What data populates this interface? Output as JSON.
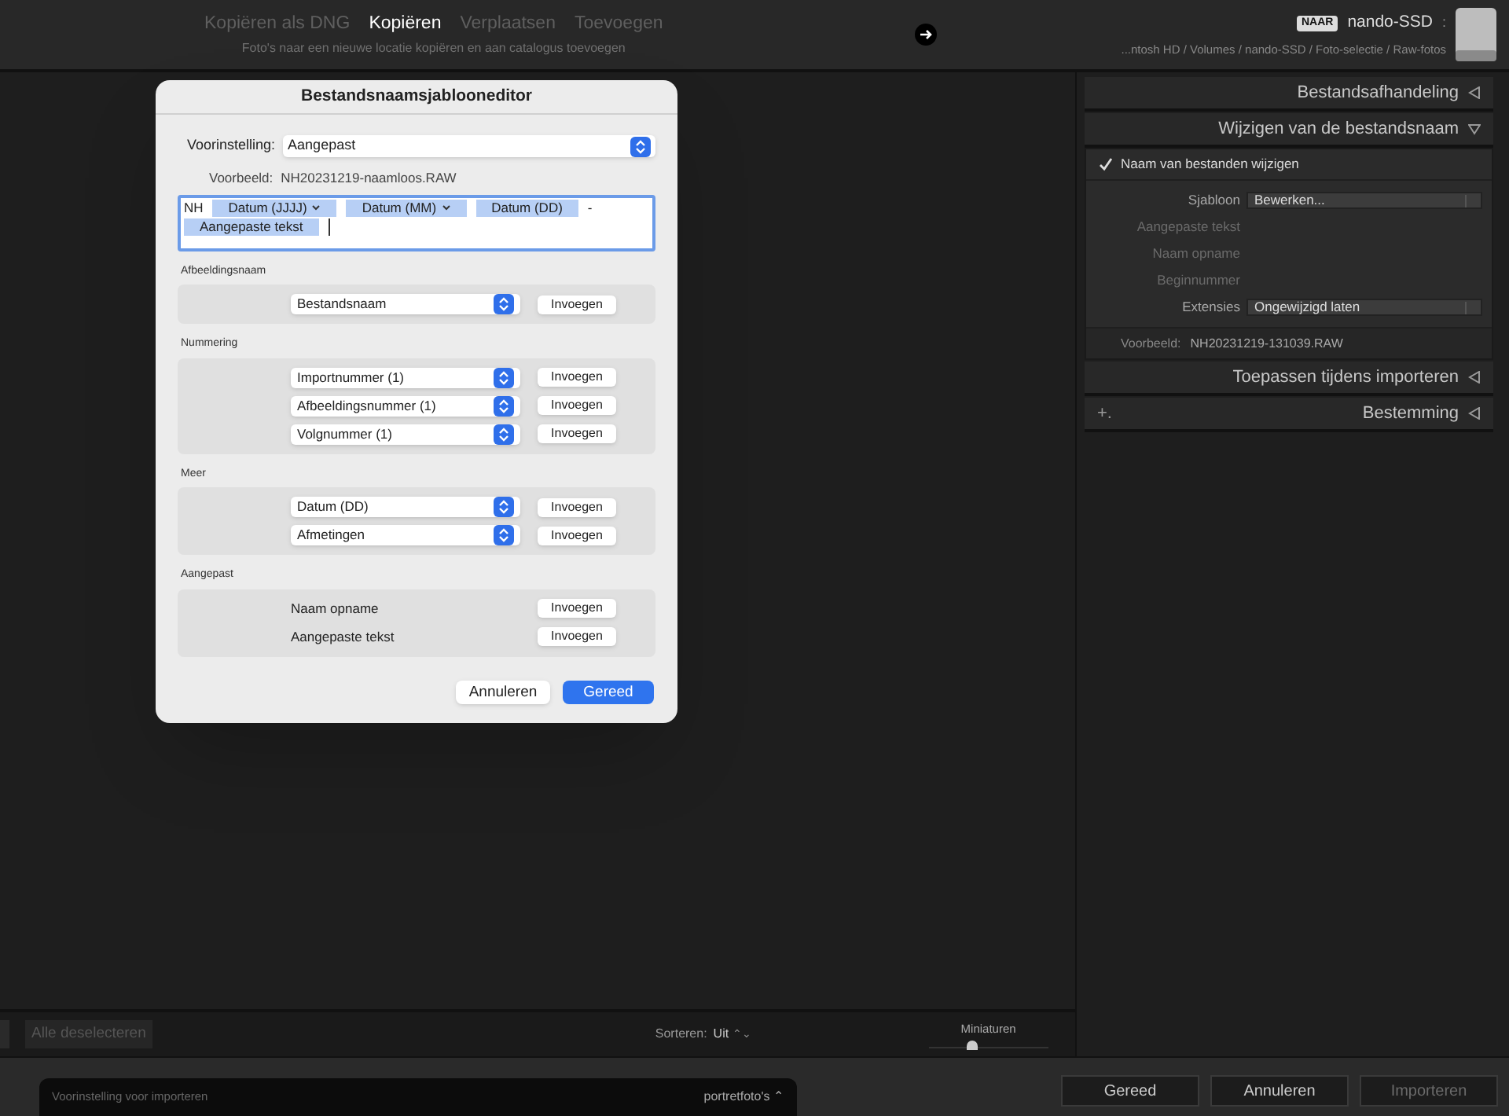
{
  "top_bar": {
    "modes": [
      {
        "label": "Kopiëren als DNG",
        "selected": false
      },
      {
        "label": "Kopiëren",
        "selected": true
      },
      {
        "label": "Verplaatsen",
        "selected": false
      },
      {
        "label": "Toevoegen",
        "selected": false
      }
    ],
    "mode_description": "Foto's naar een nieuwe locatie kopiëren en aan catalogus toevoegen",
    "destination_badge": "NAAR",
    "destination_name": "nando-SSD",
    "destination_caret": ":",
    "destination_path": "...ntosh HD / Volumes / nando-SSD / Foto-selectie / Raw-fotos"
  },
  "dialog": {
    "title": "Bestandsnaamsjablooneditor",
    "preset_label": "Voorinstelling:",
    "preset_value": "Aangepast",
    "example_label": "Voorbeeld:",
    "example_value": "NH20231219-naamloos.RAW",
    "template": [
      {
        "kind": "text",
        "text": "NH"
      },
      {
        "kind": "token",
        "text": "Datum (JJJJ)"
      },
      {
        "kind": "token",
        "text": "Datum (MM)"
      },
      {
        "kind": "token",
        "text": "Datum (DD)"
      },
      {
        "kind": "text",
        "text": "-"
      },
      {
        "kind": "token",
        "text": "Aangepaste tekst"
      }
    ],
    "sections": [
      {
        "title": "Afbeeldingsnaam",
        "rows": [
          {
            "kind": "select",
            "text": "Bestandsnaam",
            "button": "Invoegen"
          }
        ]
      },
      {
        "title": "Nummering",
        "rows": [
          {
            "kind": "select",
            "text": "Importnummer (1)",
            "button": "Invoegen"
          },
          {
            "kind": "select",
            "text": "Afbeeldingsnummer (1)",
            "button": "Invoegen"
          },
          {
            "kind": "select",
            "text": "Volgnummer (1)",
            "button": "Invoegen"
          }
        ]
      },
      {
        "title": "Meer",
        "rows": [
          {
            "kind": "select",
            "text": "Datum (DD)",
            "button": "Invoegen"
          },
          {
            "kind": "select",
            "text": "Afmetingen",
            "button": "Invoegen"
          }
        ]
      },
      {
        "title": "Aangepast",
        "rows": [
          {
            "kind": "label",
            "text": "Naam opname",
            "button": "Invoegen"
          },
          {
            "kind": "label",
            "text": "Aangepaste tekst",
            "button": "Invoegen"
          }
        ]
      }
    ],
    "cancel": "Annuleren",
    "done": "Gereed"
  },
  "grid_toolbar": {
    "deselect": "Alle deselecteren",
    "sort_label": "Sorteren:",
    "sort_value": "Uit",
    "sort_caret": "⌃⌄",
    "thumbs_label": "Miniaturen",
    "thumbs": {
      "level": 0.36
    }
  },
  "right_panel": {
    "sections": [
      {
        "title": "Bestandsafhandeling",
        "expanded": false
      },
      {
        "title": "Wijzigen van de bestandsnaam",
        "expanded": true
      },
      {
        "title": "Toepassen tijdens importeren",
        "expanded": false
      },
      {
        "title": "Bestemming",
        "expanded": false,
        "plus_text": "+."
      }
    ],
    "rename": {
      "checkbox_label": "Naam van bestanden wijzigen",
      "checked": true,
      "fields": [
        {
          "kind": "select",
          "label": "Sjabloon",
          "value": "Bewerken..."
        },
        {
          "kind": "disabled",
          "label": "Aangepaste tekst"
        },
        {
          "kind": "disabled",
          "label": "Naam opname"
        },
        {
          "kind": "disabled",
          "label": "Beginnummer"
        },
        {
          "kind": "select",
          "label": "Extensies",
          "value": "Ongewijzigd laten"
        }
      ],
      "example_label": "Voorbeeld:",
      "example_value": "NH20231219-131039.RAW"
    }
  },
  "bottom_bar": {
    "preset_label": "Voorinstelling voor importeren",
    "preset_value": "portretfoto's",
    "preset_caret": "⌃",
    "buttons": [
      {
        "label": "Gereed",
        "disabled": false
      },
      {
        "label": "Annuleren",
        "disabled": false
      },
      {
        "label": "Importeren",
        "disabled": true
      }
    ]
  }
}
